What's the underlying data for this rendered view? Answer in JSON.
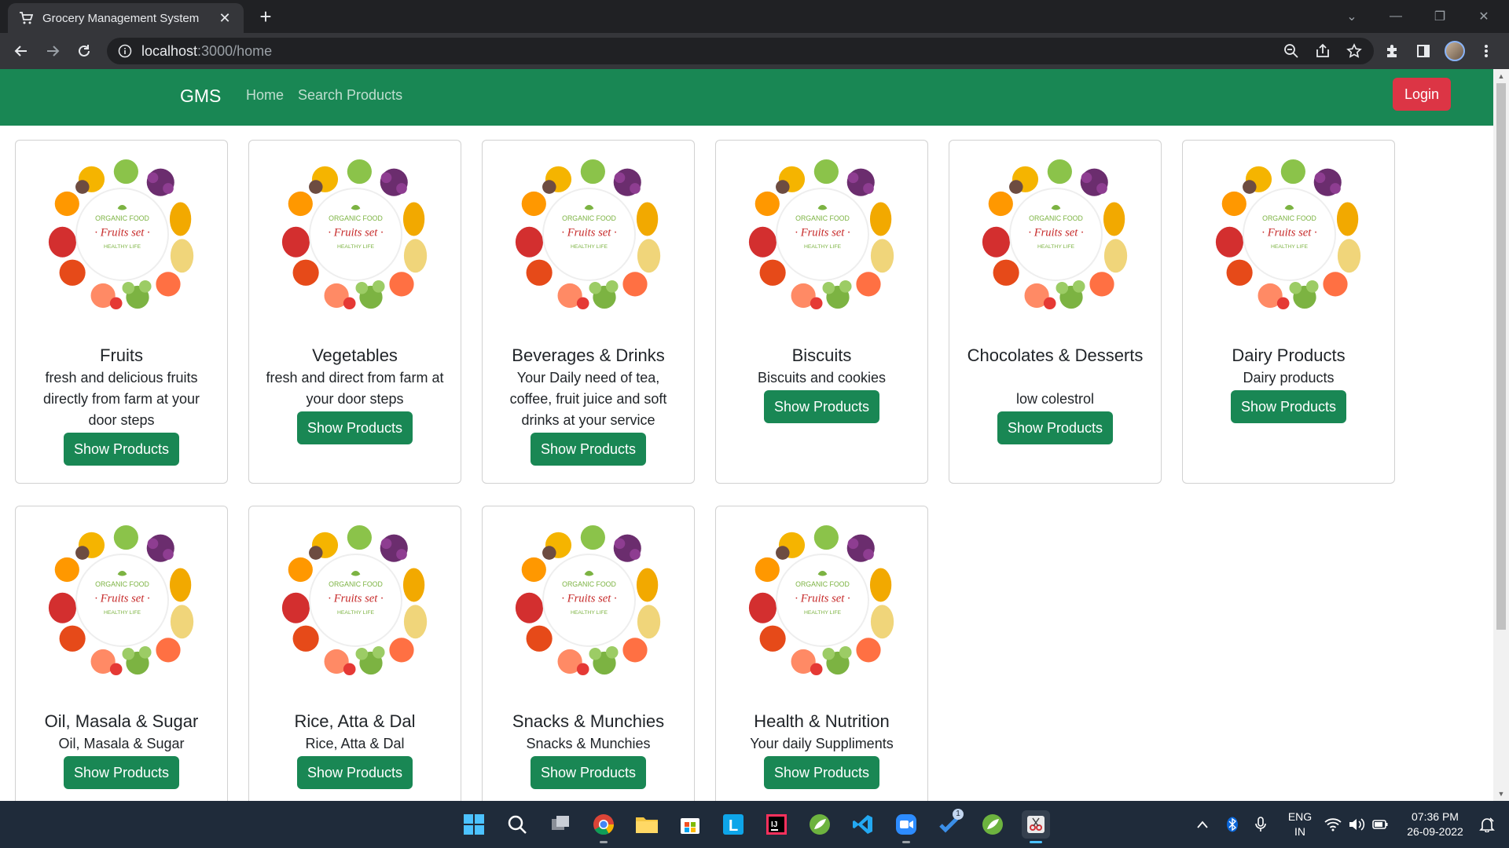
{
  "browser": {
    "tab_title": "Grocery Management System",
    "url_host": "localhost",
    "url_path": ":3000/home",
    "icons": [
      "cart-favicon",
      "close-icon",
      "plus-icon",
      "back-arrow-icon",
      "forward-arrow-icon",
      "reload-icon",
      "info-icon",
      "zoom-icon",
      "share-icon",
      "star-icon",
      "puzzle-icon",
      "side-panel-icon",
      "avatar",
      "menu-dots-icon"
    ]
  },
  "navbar": {
    "brand": "GMS",
    "links": [
      "Home",
      "Search Products"
    ],
    "login_label": "Login",
    "bg_color": "#198754",
    "login_color": "#dc3545"
  },
  "categories": [
    {
      "name": "Fruits",
      "description": "fresh and delicious fruits directly from farm at your door steps",
      "button": "Show Products"
    },
    {
      "name": "Vegetables",
      "description": "fresh and direct from farm at your door steps",
      "button": "Show Products"
    },
    {
      "name": "Beverages & Drinks",
      "description": "Your Daily need of tea, coffee, fruit juice and soft drinks at your service",
      "button": "Show Products"
    },
    {
      "name": "Biscuits",
      "description": "Biscuits and cookies",
      "button": "Show Products"
    },
    {
      "name": "Chocolates & Desserts",
      "description": "low colestrol",
      "button": "Show Products"
    },
    {
      "name": "Dairy Products",
      "description": "Dairy products",
      "button": "Show Products"
    },
    {
      "name": "Oil, Masala & Sugar",
      "description": "Oil, Masala & Sugar",
      "button": "Show Products"
    },
    {
      "name": "Rice, Atta & Dal",
      "description": "Rice, Atta & Dal",
      "button": "Show Products"
    },
    {
      "name": "Snacks & Munchies",
      "description": "Snacks & Munchies",
      "button": "Show Products"
    },
    {
      "name": "Health & Nutrition",
      "description": "Your daily Suppliments",
      "button": "Show Products"
    }
  ],
  "card_image": {
    "line1": "ORGANIC FOOD",
    "line2": "Fruits set",
    "line3": "HEALTHY LIFE"
  },
  "taskbar": {
    "lang_line1": "ENG",
    "lang_line2": "IN",
    "time": "07:36 PM",
    "date": "26-09-2022",
    "badge": "1"
  }
}
